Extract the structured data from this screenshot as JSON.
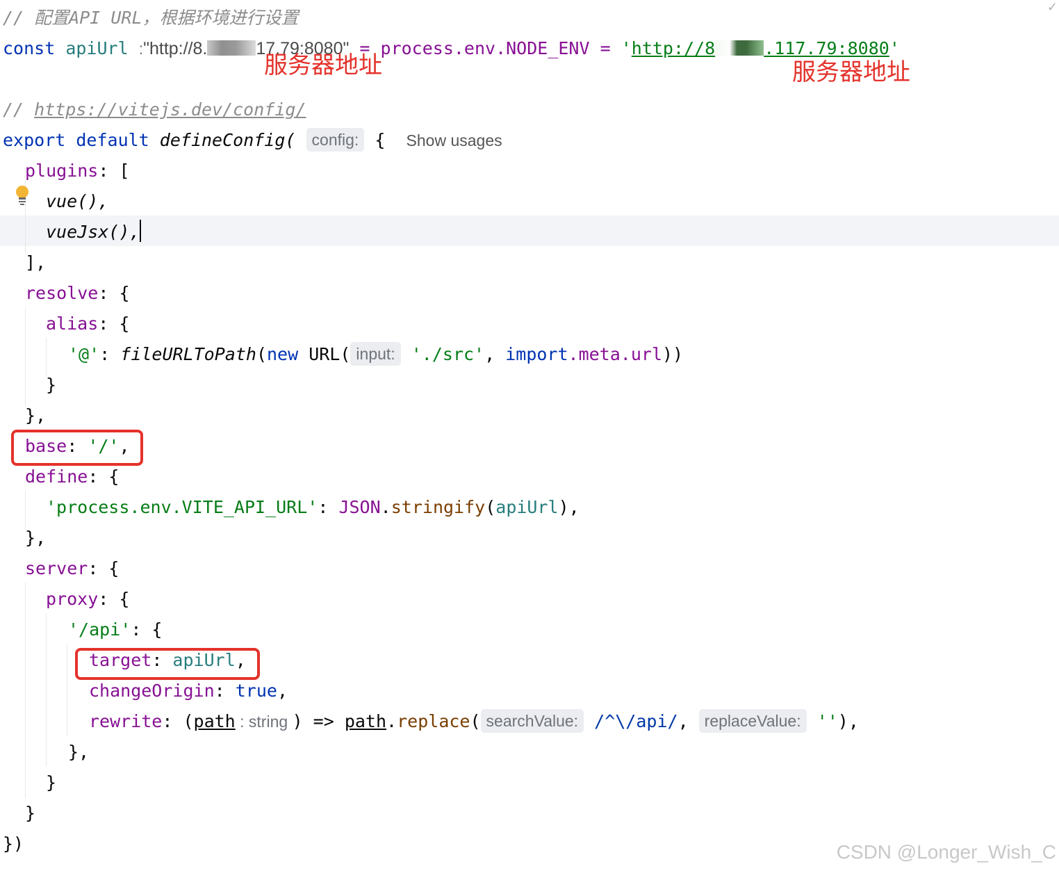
{
  "comment_config": "// 配置API URL，根据环境进行设置",
  "line_const": {
    "kw": "const",
    "name": "apiUrl",
    "colon": ":",
    "value_pre": "\"http://8.",
    "value_post": "17.79:8080\"",
    "mid": " = process.env.NODE_ENV = ",
    "url_pre": "http://8",
    "url_post": ".117.79:8080",
    "quote_open": "'",
    "quote_close": "'"
  },
  "annotation_server": "服务器地址",
  "comment_vite_prefix": "// ",
  "comment_vite_url": "https://vitejs.dev/config/",
  "line_export": {
    "kw1": "export",
    "kw2": "default",
    "fn": "defineConfig(",
    "hint": "config:",
    "brace": "{",
    "show_usages": "Show usages"
  },
  "lines": {
    "plugins_key": "plugins",
    "plugins_rest": ": [",
    "vue": "vue(),",
    "vuejsx": "vueJsx(),",
    "close_bracket": "],",
    "resolve_key": "resolve",
    "alias_key": "alias",
    "key_rest": ": {",
    "at_key": "'@'",
    "at_colon": ": ",
    "file_url_fn": "fileURLToPath",
    "paren_open": "(",
    "new_kw": "new",
    "url_cls": " URL(",
    "input_hint": "input:",
    "src_str": "'./src'",
    "comma": ", ",
    "import_kw": "import",
    "meta": ".meta.url",
    "close_parens": "))",
    "close_brace": "}",
    "close_brace_comma": "},",
    "base_key": "base",
    "base_rest": ": ",
    "base_val": "'/'",
    "base_end": ",",
    "define_key": "define",
    "env_key": "'process.env.VITE_API_URL'",
    "json_colon": ": ",
    "json_obj": "JSON",
    "dot": ".",
    "stringify": "stringify",
    "api_url_var": "apiUrl",
    "paren_close_comma": "),",
    "server_key": "server",
    "proxy_key": "proxy",
    "api_key": "'/api'",
    "target_key": "target",
    "target_rest": ": ",
    "target_val": "apiUrl",
    "target_end": ",",
    "change_origin_key": "changeOrigin",
    "true_kw": "true",
    "rewrite_key": "rewrite",
    "rewrite_open": "(",
    "path_param": "path",
    "path_type": " : string ",
    "arrow": ") => ",
    "path_var": "path",
    "replace": "replace",
    "search_hint": "searchValue:",
    "regex": "/^\\/api/",
    "replace_hint": "replaceValue:",
    "empty_str": "''",
    "rewrite_end": "),",
    "final": "})"
  },
  "watermark": "CSDN @Longer_Wish_C"
}
